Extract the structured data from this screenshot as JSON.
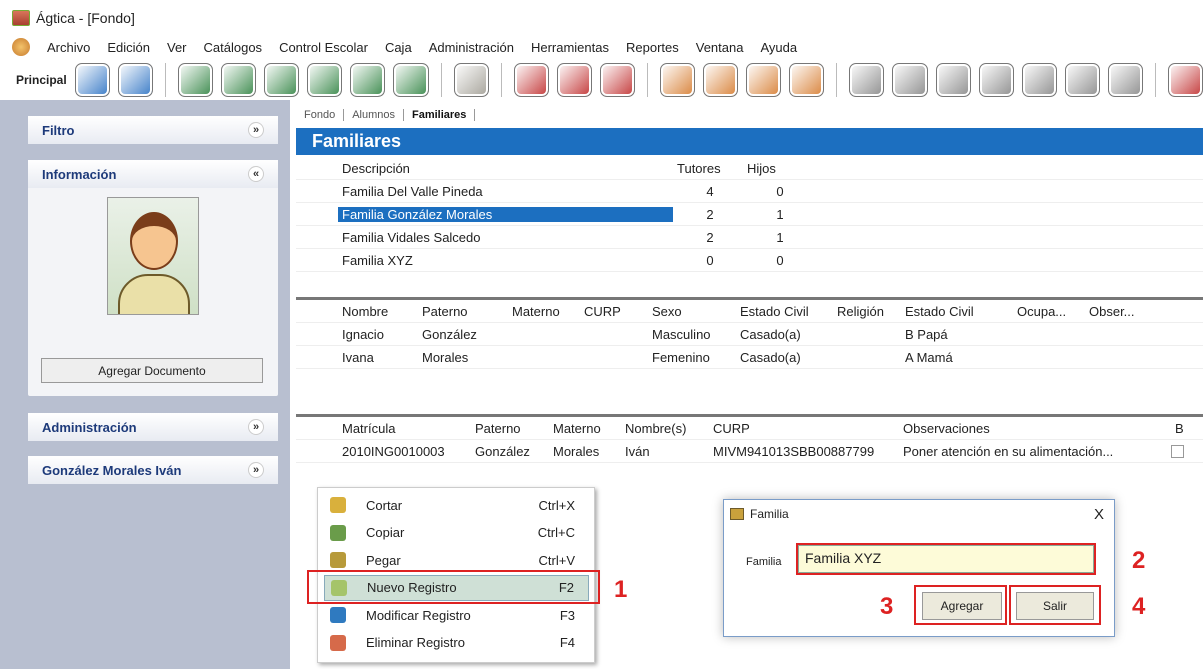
{
  "window": {
    "title": "Ágtica - [Fondo]"
  },
  "menu": [
    "Archivo",
    "Edición",
    "Ver",
    "Catálogos",
    "Control Escolar",
    "Caja",
    "Administración",
    "Herramientas",
    "Reportes",
    "Ventana",
    "Ayuda"
  ],
  "toolbar": {
    "label": "Principal",
    "groups": [
      [
        "#3a7cc7",
        "#3a7cc7"
      ],
      [
        "#3d8b4e",
        "#3d8b4e",
        "#3d8b4e",
        "#3d8b4e",
        "#3d8b4e",
        "#3d8b4e"
      ],
      [
        "#a6a39a"
      ],
      [
        "#c43b3b",
        "#c43b3b",
        "#c43b3b"
      ],
      [
        "#d9843c",
        "#d9843c",
        "#d9843c",
        "#d9843c"
      ],
      [
        "#8f8f8f",
        "#8f8f8f",
        "#8f8f8f",
        "#8f8f8f",
        "#8f8f8f",
        "#8f8f8f",
        "#8f8f8f"
      ],
      [
        "#c43b3b"
      ]
    ]
  },
  "sidebar": {
    "filtro": "Filtro",
    "informacion": "Información",
    "agregar_documento": "Agregar Documento",
    "administracion": "Administración",
    "alumno": "González Morales Iván"
  },
  "tabs": [
    "Fondo",
    "Alumnos",
    "Familiares"
  ],
  "section_title": "Familiares",
  "familias": {
    "columns": [
      "Descripción",
      "Tutores",
      "Hijos"
    ],
    "rows": [
      [
        "Familia Del Valle Pineda",
        "4",
        "0"
      ],
      [
        "Familia González Morales",
        "2",
        "1"
      ],
      [
        "Familia Vidales Salcedo",
        "2",
        "1"
      ],
      [
        "Familia XYZ",
        "0",
        "0"
      ]
    ]
  },
  "tutores": {
    "columns": [
      "Nombre",
      "Paterno",
      "Materno",
      "CURP",
      "Sexo",
      "Estado Civil",
      "Religión",
      "Estado Civil",
      "Ocupa...",
      "Obser..."
    ],
    "rows": [
      [
        "Ignacio",
        "González",
        "",
        "",
        "Masculino",
        "Casado(a)",
        "",
        "B Papá",
        "",
        ""
      ],
      [
        "Ivana",
        "Morales",
        "",
        "",
        "Femenino",
        "Casado(a)",
        "",
        "A Mamá",
        "",
        ""
      ]
    ]
  },
  "alumnos": {
    "columns": [
      "Matrícula",
      "Paterno",
      "Materno",
      "Nombre(s)",
      "CURP",
      "Observaciones",
      "B"
    ],
    "rows": [
      [
        "2010ING0010003",
        "González",
        "Morales",
        "Iván",
        "MIVM941013SBB00887799",
        "Poner atención en su alimentación...",
        ""
      ]
    ]
  },
  "context_menu": [
    {
      "label": "Cortar",
      "shortcut": "Ctrl+X"
    },
    {
      "label": "Copiar",
      "shortcut": "Ctrl+C"
    },
    {
      "label": "Pegar",
      "shortcut": "Ctrl+V"
    },
    {
      "label": "Nuevo Registro",
      "shortcut": "F2"
    },
    {
      "label": "Modificar Registro",
      "shortcut": "F3"
    },
    {
      "label": "Eliminar Registro",
      "shortcut": "F4"
    }
  ],
  "dialog": {
    "title": "Familia",
    "close": "X",
    "field_label": "Familia",
    "field_value": "Familia XYZ",
    "add": "Agregar",
    "exit": "Salir"
  },
  "annotations": [
    "1",
    "2",
    "3",
    "4"
  ]
}
